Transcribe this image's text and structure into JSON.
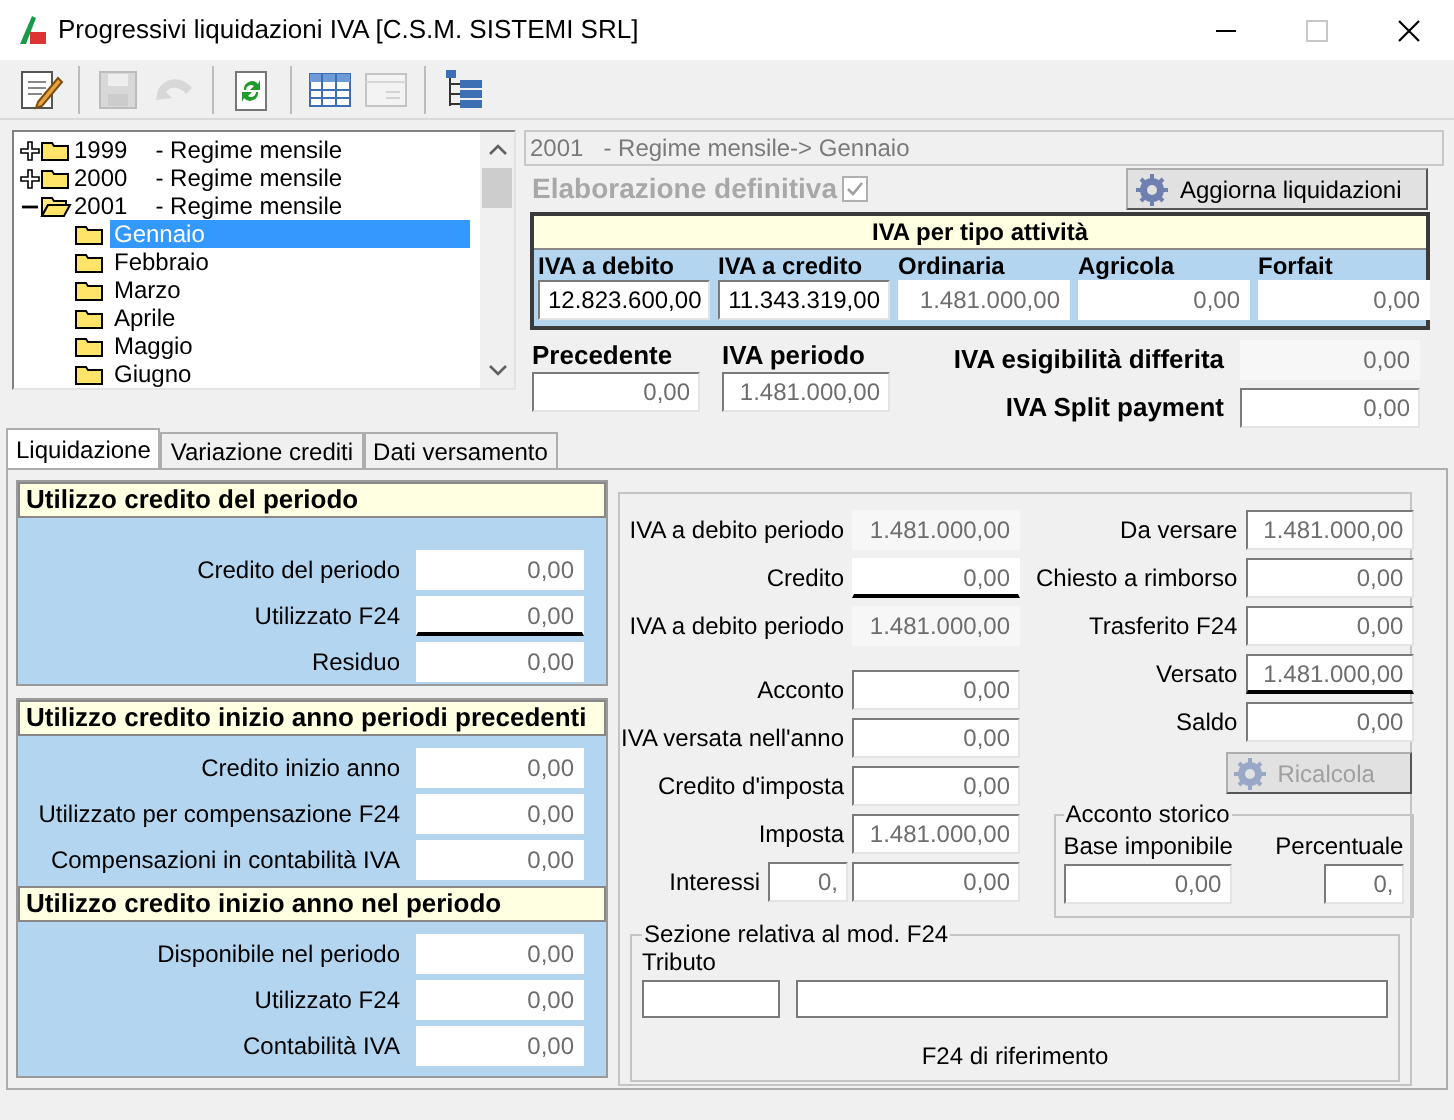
{
  "window": {
    "title": "Progressivi liquidazioni IVA [C.S.M. SISTEMI SRL]"
  },
  "toolbar": [
    [
      {
        "kind": "edit",
        "disabled": false
      }
    ],
    [
      {
        "kind": "save",
        "disabled": true
      },
      {
        "kind": "undo",
        "disabled": true
      }
    ],
    [
      {
        "kind": "refresh",
        "disabled": false
      }
    ],
    [
      {
        "kind": "grid",
        "disabled": false
      },
      {
        "kind": "form",
        "disabled": true
      }
    ],
    [
      {
        "kind": "tree",
        "disabled": false
      }
    ]
  ],
  "tree": [
    {
      "year": "1999",
      "regime": "- Regime mensile",
      "expanded": false
    },
    {
      "year": "2000",
      "regime": "- Regime mensile",
      "expanded": false
    },
    {
      "year": "2001",
      "regime": "- Regime mensile",
      "expanded": true,
      "children": [
        {
          "label": "Gennaio",
          "selected": true
        },
        {
          "label": "Febbraio",
          "selected": false
        },
        {
          "label": "Marzo",
          "selected": false
        },
        {
          "label": "Aprile",
          "selected": false
        },
        {
          "label": "Maggio",
          "selected": false
        },
        {
          "label": "Giugno",
          "selected": false
        }
      ]
    }
  ],
  "period_field": {
    "value": "2001   - Regime mensile-> Gennaio"
  },
  "elaborazione": {
    "label": "Elaborazione definitiva",
    "checked": true,
    "disabled": true
  },
  "aggiorna_button": {
    "label": "Aggiorna liquidazioni",
    "disabled": false
  },
  "iva_per_tipo": {
    "title": "IVA per tipo attività",
    "columns": [
      {
        "label": "IVA a debito",
        "value": "12.823.600,00",
        "kind": "sunken",
        "readonly": false
      },
      {
        "label": "IVA a credito",
        "value": "11.343.319,00",
        "kind": "sunken",
        "readonly": false
      },
      {
        "label": "Ordinaria",
        "value": "1.481.000,00",
        "kind": "flat",
        "readonly": true
      },
      {
        "label": "Agricola",
        "value": "0,00",
        "kind": "flat",
        "readonly": true
      },
      {
        "label": "Forfait",
        "value": "0,00",
        "kind": "flat",
        "readonly": true
      }
    ]
  },
  "precedente": {
    "label": "Precedente",
    "value": "0,00",
    "kind": "sunken",
    "readonly": true
  },
  "iva_periodo": {
    "label": "IVA periodo",
    "value": "1.481.000,00",
    "kind": "sunken",
    "readonly": true
  },
  "esigibilita_differita": {
    "label": "IVA esigibilità differita",
    "value": "0,00",
    "kind": "shaded",
    "readonly": true
  },
  "split_payment": {
    "label": "IVA Split payment",
    "value": "0,00",
    "kind": "sunken",
    "readonly": true
  },
  "tabs": [
    {
      "label": "Liquidazione",
      "selected": true
    },
    {
      "label": "Variazione crediti",
      "selected": false
    },
    {
      "label": "Dati versamento",
      "selected": false
    }
  ],
  "credit_panels": [
    {
      "sections": [
        {
          "title": "Utilizzo credito del periodo",
          "rows": [
            {
              "label": "Credito del periodo",
              "value": "0,00",
              "underline": false
            },
            {
              "label": "Utilizzato F24",
              "value": "0,00",
              "underline": true
            },
            {
              "label": "Residuo",
              "value": "0,00",
              "underline": false
            }
          ]
        }
      ]
    },
    {
      "sections": [
        {
          "title": "Utilizzo credito inizio anno periodi precedenti",
          "rows": [
            {
              "label": "Credito inizio anno",
              "value": "0,00",
              "underline": false
            },
            {
              "label": "Utilizzato per compensazione F24",
              "value": "0,00",
              "underline": false
            },
            {
              "label": "Compensazioni in contabilità IVA",
              "value": "0,00",
              "underline": false
            }
          ]
        },
        {
          "title": "Utilizzo credito inizio anno nel periodo",
          "rows": [
            {
              "label": "Disponibile nel periodo",
              "value": "0,00",
              "underline": false
            },
            {
              "label": "Utilizzato F24",
              "value": "0,00",
              "underline": false
            },
            {
              "label": "Contabilità IVA",
              "value": "0,00",
              "underline": false
            }
          ]
        }
      ]
    }
  ],
  "debito_rows": [
    {
      "label": "IVA a debito periodo",
      "underline": false,
      "fields": [
        {
          "value": "1.481.000,00",
          "kind": "shaded",
          "readonly": true
        }
      ]
    },
    {
      "label": "Credito",
      "underline": true,
      "fields": [
        {
          "value": "0,00",
          "kind": "flat",
          "readonly": true
        }
      ]
    },
    {
      "label": "IVA a debito periodo",
      "underline": false,
      "fields": [
        {
          "value": "1.481.000,00",
          "kind": "shaded",
          "readonly": true
        }
      ]
    }
  ],
  "imposta_rows": [
    {
      "label": "Acconto",
      "fields": [
        {
          "value": "0,00",
          "kind": "sunken",
          "readonly": true
        }
      ]
    },
    {
      "label": "IVA versata nell'anno",
      "fields": [
        {
          "value": "0,00",
          "kind": "sunken",
          "readonly": true
        }
      ]
    },
    {
      "label": "Credito d'imposta",
      "fields": [
        {
          "value": "0,00",
          "kind": "sunken",
          "readonly": true
        }
      ]
    },
    {
      "label": "Imposta",
      "fields": [
        {
          "value": "1.481.000,00",
          "kind": "sunken",
          "readonly": true
        }
      ]
    },
    {
      "label": "Interessi",
      "fields": [
        {
          "value": "0,",
          "kind": "sunken",
          "readonly": true
        },
        {
          "value": "0,00",
          "kind": "sunken",
          "readonly": true
        }
      ]
    }
  ],
  "versamento_rows": [
    {
      "label": "Da versare",
      "value": "1.481.000,00",
      "underline": false
    },
    {
      "label": "Chiesto a rimborso",
      "value": "0,00",
      "underline": false
    },
    {
      "label": "Trasferito F24",
      "value": "0,00",
      "underline": false
    },
    {
      "label": "Versato",
      "value": "1.481.000,00",
      "underline": true
    },
    {
      "label": "Saldo",
      "value": "0,00",
      "underline": false
    }
  ],
  "ricalcola_button": {
    "label": "Ricalcola",
    "disabled": true
  },
  "acconto_storico": {
    "title": "Acconto storico",
    "base_label": "Base imponibile",
    "base_value": "0,00",
    "perc_label": "Percentuale",
    "perc_value": "0,"
  },
  "f24_section": {
    "title": "Sezione relativa al mod. F24",
    "tributo_label": "Tributo",
    "caption": "F24 di riferimento"
  }
}
